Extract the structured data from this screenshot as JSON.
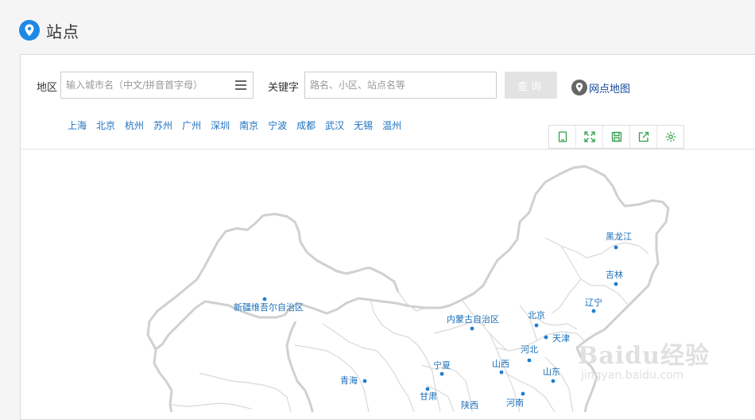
{
  "header": {
    "title": "站点"
  },
  "search": {
    "region_label": "地区",
    "region_placeholder": "输入城市名（中文/拼音首字母）",
    "keyword_label": "关键字",
    "keyword_placeholder": "路名、小区、站点名等",
    "query_button": "查询",
    "netmap_link": "网点地图"
  },
  "cities": [
    "上海",
    "北京",
    "杭州",
    "苏州",
    "广州",
    "深圳",
    "南京",
    "宁波",
    "成都",
    "武汉",
    "无锡",
    "温州"
  ],
  "toolbar": {
    "icons": [
      "bookmark-icon",
      "fullscreen-icon",
      "save-icon",
      "export-icon",
      "settings-icon"
    ]
  },
  "map": {
    "provinces": [
      "黑龙江",
      "吉林",
      "辽宁",
      "内蒙古自治区",
      "北京",
      "天津",
      "河北",
      "山西",
      "山东",
      "新疆维吾尔自治区",
      "宁夏",
      "青海",
      "甘肃",
      "陕西",
      "河南"
    ]
  },
  "colors": {
    "accent": "#1e88e5",
    "link": "#1e71c0",
    "map_label": "#1a6fb8",
    "border": "#cccccc"
  },
  "watermark": {
    "top": "Baidu经验",
    "bottom": "jingyan.baidu.com"
  }
}
